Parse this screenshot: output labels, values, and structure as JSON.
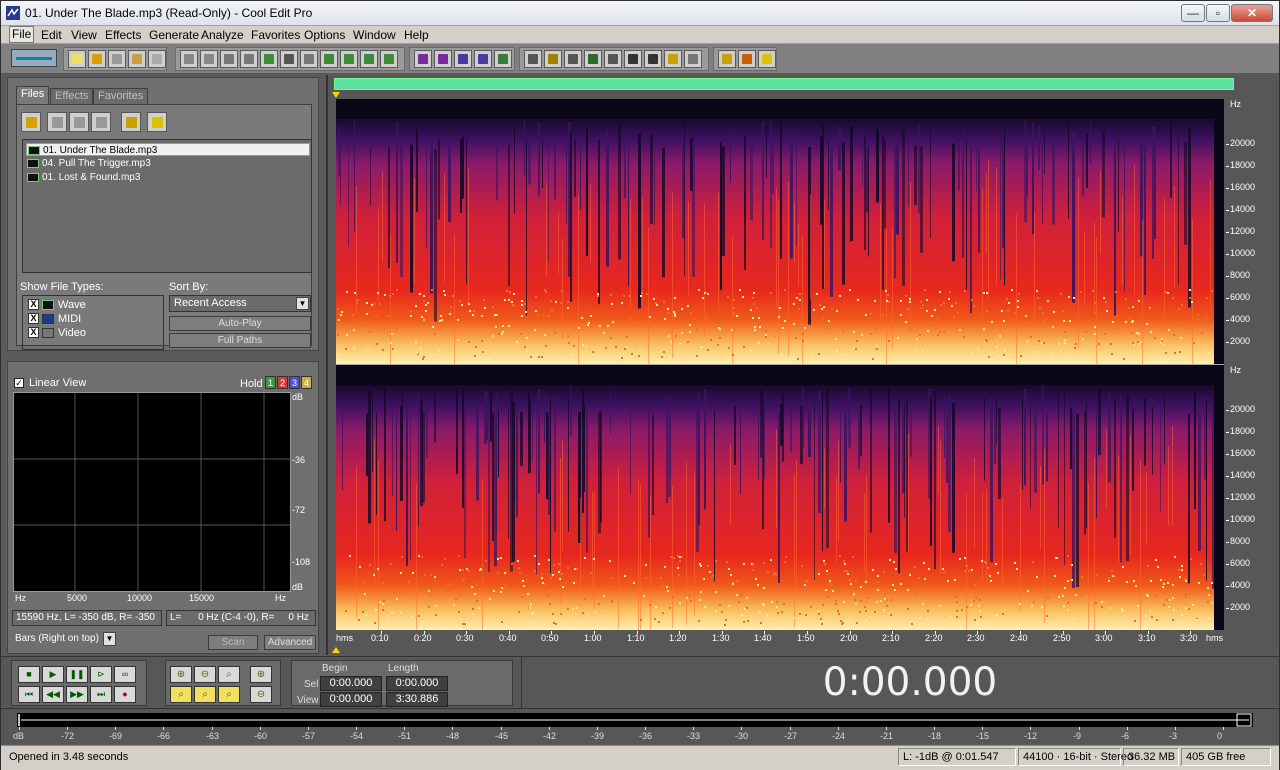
{
  "window": {
    "title": "01. Under The Blade.mp3 (Read-Only) - Cool Edit Pro",
    "minimize_label": "—",
    "maximize_label": "▫",
    "close_label": "✕"
  },
  "menu": [
    "File",
    "Edit",
    "View",
    "Effects",
    "Generate",
    "Analyze",
    "Favorites",
    "Options",
    "Window",
    "Help"
  ],
  "organizer": {
    "tabs": [
      "Files",
      "Effects",
      "Favorites"
    ],
    "files": [
      "01. Under The Blade.mp3",
      "04. Pull The Trigger.mp3",
      "01. Lost & Found.mp3"
    ],
    "selected_index": 0,
    "show_file_types_label": "Show File Types:",
    "file_types": [
      {
        "label": "Wave",
        "checked": true
      },
      {
        "label": "MIDI",
        "checked": true
      },
      {
        "label": "Video",
        "checked": true
      }
    ],
    "sort_by_label": "Sort By:",
    "sort_value": "Recent Access",
    "auto_play_label": "Auto-Play",
    "full_paths_label": "Full Paths"
  },
  "frequency_analysis": {
    "linear_view_label": "Linear View",
    "linear_view_checked": true,
    "hold_label": "Hold",
    "hold_buttons": [
      "1",
      "2",
      "3",
      "4"
    ],
    "hold_colors": [
      "#3c9a3c",
      "#c84040",
      "#5050c8",
      "#c8b040"
    ],
    "db_labels": [
      "dB",
      "-36",
      "-72",
      "-108",
      "dB"
    ],
    "x_labels": [
      "Hz",
      "5000",
      "10000",
      "15000",
      "Hz"
    ],
    "cursor_info": "15590 Hz, L= -350 dB, R= -350",
    "peak_info": "L=      0 Hz (C-4 -0), R=     0 Hz",
    "display_mode": "Bars (Right on top)",
    "scan_label": "Scan",
    "advanced_label": "Advanced"
  },
  "spectral_view": {
    "hz_unit": "Hz",
    "hz_labels": [
      "20000",
      "18000",
      "16000",
      "14000",
      "12000",
      "10000",
      "8000",
      "6000",
      "4000",
      "2000"
    ],
    "time_labels": [
      "hms",
      "0:10",
      "0:20",
      "0:30",
      "0:40",
      "0:50",
      "1:00",
      "1:10",
      "1:20",
      "1:30",
      "1:40",
      "1:50",
      "2:00",
      "2:10",
      "2:20",
      "2:30",
      "2:40",
      "2:50",
      "3:00",
      "3:10",
      "3:20",
      "hms"
    ]
  },
  "transport": {
    "begin_label": "Begin",
    "length_label": "Length",
    "sel_label": "Sel",
    "view_label": "View",
    "sel_begin": "0:00.000",
    "sel_length": "0:00.000",
    "view_begin": "0:00.000",
    "view_length": "3:30.886",
    "time_display": "0:00.000"
  },
  "level_meter": {
    "labels": [
      "dB",
      "-72",
      "-69",
      "-66",
      "-63",
      "-60",
      "-57",
      "-54",
      "-51",
      "-48",
      "-45",
      "-42",
      "-39",
      "-36",
      "-33",
      "-30",
      "-27",
      "-24",
      "-21",
      "-18",
      "-15",
      "-12",
      "-9",
      "-6",
      "-3",
      "0"
    ]
  },
  "status": {
    "message": "Opened in 3.48 seconds",
    "position": "L: -1dB @  0:01.547",
    "format": "44100 · 16-bit · Stereo",
    "size": "36.32 MB",
    "free": "405 GB free"
  },
  "colors": {
    "overview_bar": "#5ee0a0",
    "spectrum_high": "#ffe8a0",
    "spectrum_mid": "#e8202a",
    "spectrum_low": "#5a1a7a"
  }
}
